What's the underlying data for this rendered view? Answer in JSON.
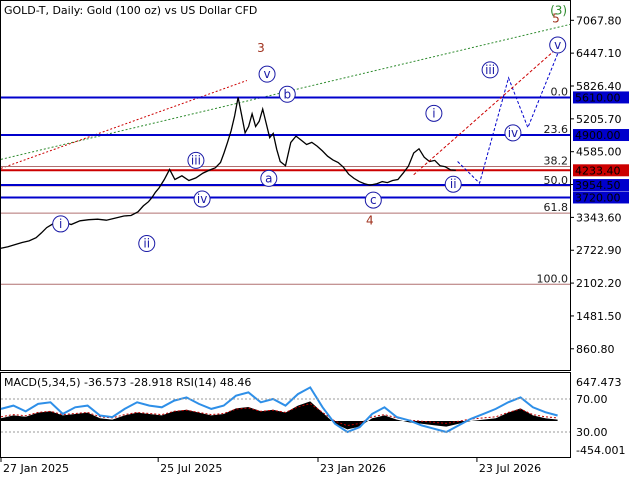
{
  "header": {
    "symbol_label": "GOLD-T, Daily:  Gold (100 oz) vs US Dollar CFD"
  },
  "indicator": {
    "macd_label": "MACD(5,34,5) -36.573 -28.918 RSI(14) 48.46"
  },
  "colors": {
    "price": "#000000",
    "blue_level": "#0000cc",
    "red_level": "#cc0000",
    "fib_line": "#b07070",
    "wave_blue": "#1a1aa6",
    "wave_red": "#a0321e",
    "wave_green": "#2e8b2e",
    "macd_hist": "#000000",
    "rsi_line": "#2e8fe8",
    "signal_line": "#c00000"
  },
  "chart_data": {
    "type": "line",
    "title": "GOLD-T, Daily:  Gold (100 oz) vs US Dollar CFD",
    "y_axis_ticks": [
      "7067.80",
      "6447.10",
      "5826.40",
      "5205.70",
      "4585.00",
      "3964.30",
      "3343.60",
      "2722.90",
      "2102.20",
      "1481.50",
      "860.80"
    ],
    "ylim": [
      460,
      7300
    ],
    "x_axis_ticks": [
      "27 Jan 2025",
      "25 Jul 2025",
      "23 Jan 2026",
      "23 Jul 2026"
    ],
    "x_tick_days": [
      0,
      179,
      361,
      542
    ],
    "xlim_days": [
      0,
      648
    ],
    "price_series": {
      "x_days": [
        0,
        8,
        16,
        24,
        32,
        40,
        46,
        52,
        60,
        70,
        80,
        90,
        100,
        110,
        120,
        130,
        140,
        148,
        156,
        162,
        168,
        172,
        176,
        180,
        186,
        192,
        198,
        206,
        214,
        222,
        230,
        238,
        244,
        250,
        254,
        258,
        262,
        266,
        270,
        274,
        278,
        282,
        286,
        290,
        294,
        298,
        302,
        306,
        310,
        314,
        318,
        324,
        330,
        336,
        342,
        348,
        354,
        360,
        366,
        372,
        378,
        384,
        390,
        396,
        402,
        408,
        414,
        420,
        428,
        434,
        440,
        446,
        452,
        458,
        464,
        470,
        476,
        482,
        488,
        494,
        500,
        506,
        512,
        518,
        524,
        530,
        536,
        540,
        546,
        550,
        556,
        562,
        568
      ],
      "values": [
        2760,
        2790,
        2830,
        2870,
        2900,
        2960,
        3050,
        3150,
        3230,
        3260,
        3210,
        3280,
        3300,
        3310,
        3290,
        3330,
        3370,
        3380,
        3450,
        3560,
        3640,
        3720,
        3820,
        3900,
        4060,
        4250,
        4060,
        4130,
        4040,
        4090,
        4180,
        4240,
        4280,
        4380,
        4560,
        4760,
        4980,
        5260,
        5610,
        5280,
        4940,
        5060,
        5300,
        5060,
        5160,
        5390,
        5120,
        4850,
        4930,
        4630,
        4400,
        4320,
        4760,
        4880,
        4800,
        4720,
        4760,
        4690,
        4600,
        4500,
        4430,
        4380,
        4290,
        4160,
        4080,
        4020,
        3980,
        3954,
        3980,
        4020,
        4000,
        4040,
        4060,
        4180,
        4310,
        4560,
        4640,
        4480,
        4400,
        4420,
        4320,
        4300,
        4240,
        4233
      ],
      "note": ""
    },
    "horizontal_levels": [
      {
        "value": 5610.0,
        "label": "5610.00",
        "color": "blue"
      },
      {
        "value": 4900.0,
        "label": "4900.00",
        "color": "blue"
      },
      {
        "value": 4233.4,
        "label": "4233.40",
        "color": "red"
      },
      {
        "value": 3954.5,
        "label": "3954.50",
        "color": "blue"
      },
      {
        "value": 3720.0,
        "label": "3720.00",
        "color": "blue"
      }
    ],
    "fibonacci_levels": [
      {
        "ratio": "0.0",
        "value": 5610
      },
      {
        "ratio": "23.6",
        "value": 4903
      },
      {
        "ratio": "38.2",
        "value": 4305
      },
      {
        "ratio": "50.0",
        "value": 3940
      },
      {
        "ratio": "61.8",
        "value": 3425
      },
      {
        "ratio": "100.0",
        "value": 2080
      }
    ],
    "wave_labels_blue": [
      {
        "text": "i",
        "day": 68,
        "value": 3220
      },
      {
        "text": "ii",
        "day": 166,
        "value": 2850
      },
      {
        "text": "iii",
        "day": 222,
        "value": 4420
      },
      {
        "text": "iv",
        "day": 229,
        "value": 3690
      },
      {
        "text": "v",
        "day": 303,
        "value": 6050
      },
      {
        "text": "a",
        "day": 305,
        "value": 4080
      },
      {
        "text": "b",
        "day": 326,
        "value": 5670
      },
      {
        "text": "c",
        "day": 424,
        "value": 3670
      },
      {
        "text": "i",
        "day": 493,
        "value": 5310
      },
      {
        "text": "ii",
        "day": 515,
        "value": 3970
      },
      {
        "text": "iii",
        "day": 557,
        "value": 6130
      },
      {
        "text": "iv",
        "day": 583,
        "value": 4940
      },
      {
        "text": "v",
        "day": 634,
        "value": 6600
      }
    ],
    "wave_labels_red": [
      {
        "text": "3",
        "day": 296,
        "value": 6470
      },
      {
        "text": "4",
        "day": 420,
        "value": 3210
      },
      {
        "text": "5",
        "day": 632,
        "value": 7030
      }
    ],
    "wave_labels_green": [
      {
        "text": "(3)",
        "day": 635,
        "value": 7180
      }
    ],
    "forecast_blue_path": [
      {
        "day": 520,
        "value": 4400
      },
      {
        "day": 545,
        "value": 3990
      },
      {
        "day": 578,
        "value": 5980
      },
      {
        "day": 600,
        "value": 5040
      },
      {
        "day": 636,
        "value": 6520
      }
    ],
    "forecast_red_path": [
      {
        "day": 470,
        "value": 4150
      },
      {
        "day": 636,
        "value": 6580
      }
    ],
    "channel_green": [
      {
        "day": 0,
        "value": 4440
      },
      {
        "day": 648,
        "value": 6990
      }
    ],
    "channel_red": [
      {
        "day": 0,
        "value": 4270
      },
      {
        "day": 280,
        "value": 5930
      }
    ],
    "indicator_panel": {
      "right_ticks": [
        "647.473",
        "70.00",
        "30.00",
        "-454.001"
      ],
      "macd_hist_sample": [
        0.1,
        0.2,
        0.15,
        0.3,
        0.35,
        0.2,
        0.25,
        0.3,
        0.1,
        0.05,
        0.2,
        0.3,
        0.25,
        0.2,
        0.35,
        0.4,
        0.3,
        0.2,
        0.25,
        0.45,
        0.5,
        0.35,
        0.4,
        0.3,
        0.55,
        0.7,
        0.3,
        -0.1,
        -0.3,
        -0.2,
        0.1,
        0.2,
        0.05,
        -0.05,
        -0.1,
        -0.15,
        -0.2,
        -0.1,
        0.0,
        0.05,
        0.1,
        0.3,
        0.45,
        0.2,
        0.1,
        0.05
      ],
      "rsi_sample": [
        58,
        62,
        55,
        64,
        66,
        52,
        60,
        62,
        50,
        48,
        58,
        66,
        62,
        60,
        68,
        72,
        64,
        58,
        62,
        74,
        78,
        66,
        70,
        62,
        76,
        84,
        60,
        40,
        30,
        36,
        52,
        60,
        48,
        44,
        38,
        34,
        30,
        38,
        46,
        52,
        58,
        66,
        72,
        60,
        54,
        50
      ]
    }
  }
}
